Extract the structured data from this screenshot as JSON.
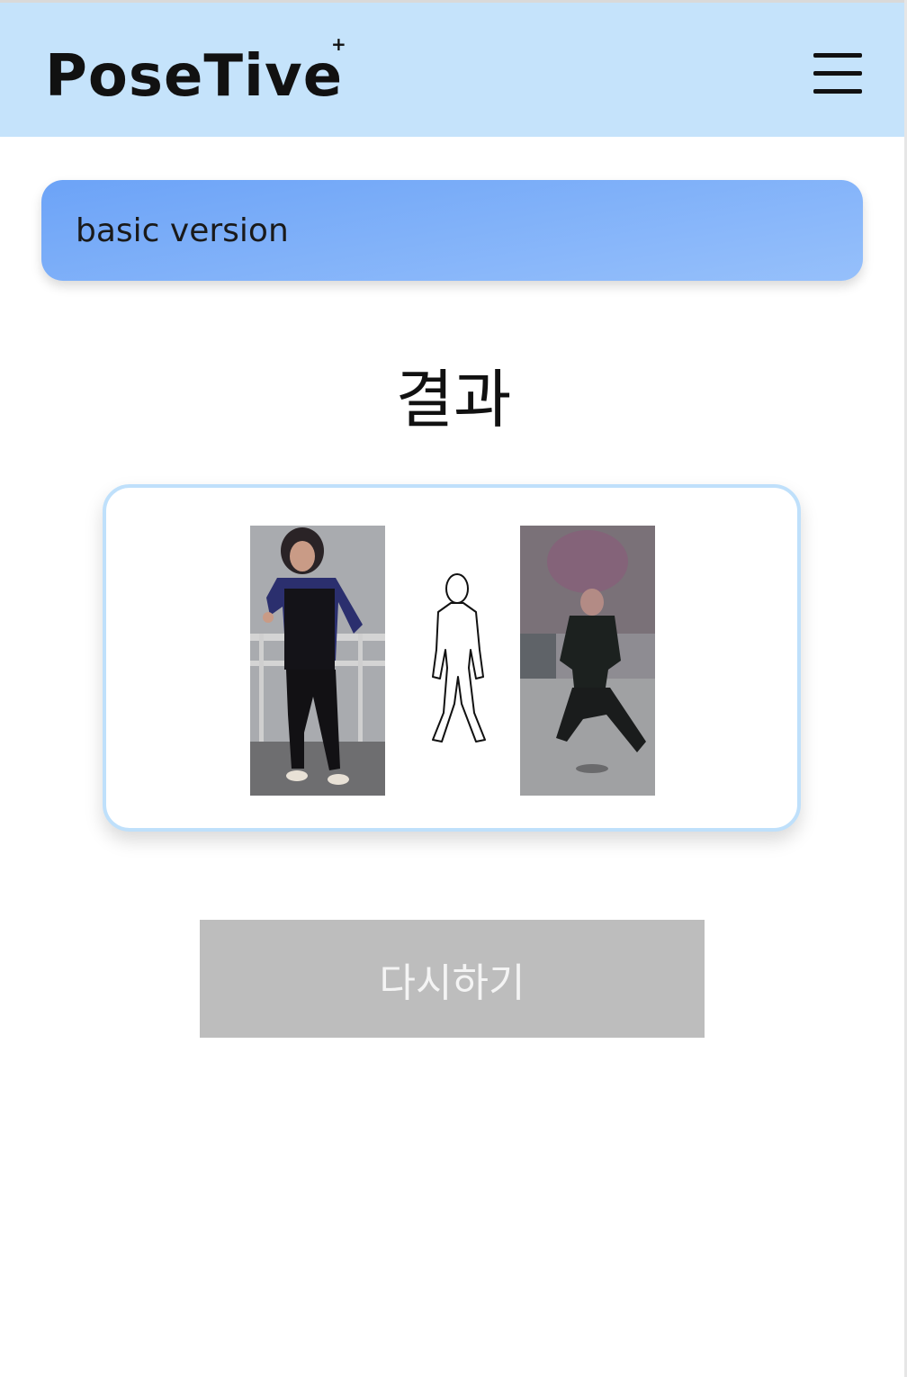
{
  "header": {
    "logo_text": "PoseTive",
    "logo_plus": "+",
    "menu_icon": "hamburger-menu-icon"
  },
  "banner": {
    "label": "basic version",
    "gradient_start": "#6ca3f7",
    "gradient_end": "#96c0fb"
  },
  "result": {
    "title": "결과",
    "card_border_color": "#bfe0fb",
    "images": [
      {
        "name": "input-person-photo",
        "description_icon": "person-photo"
      },
      {
        "name": "target-pose-sketch",
        "description_icon": "pose-outline"
      },
      {
        "name": "generated-person-photo",
        "description_icon": "person-photo"
      }
    ]
  },
  "actions": {
    "retry_label": "다시하기",
    "retry_bg": "#bdbdbd"
  },
  "colors": {
    "header_bg": "#c5e3fb"
  }
}
